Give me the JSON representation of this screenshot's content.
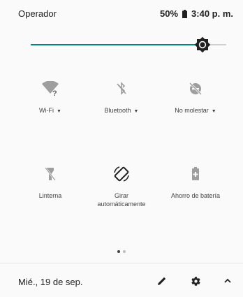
{
  "status_bar": {
    "carrier": "Operador",
    "battery_percent": "50%",
    "time": "3:40 p. m."
  },
  "brightness": {
    "level": 0.88,
    "accent_color": "#00897b"
  },
  "tiles": [
    {
      "label": "Wi-Fi",
      "icon": "wifi-off-icon",
      "has_dropdown": true,
      "caret": "▼"
    },
    {
      "label": "Bluetooth",
      "icon": "bluetooth-off-icon",
      "has_dropdown": true,
      "caret": "▼"
    },
    {
      "label": "No molestar",
      "icon": "do-not-disturb-off-icon",
      "has_dropdown": true,
      "caret": "▼"
    },
    {
      "label": "Linterna",
      "icon": "flashlight-off-icon",
      "has_dropdown": false
    },
    {
      "label": "Girar automáticamente",
      "icon": "auto-rotate-icon",
      "has_dropdown": false
    },
    {
      "label": "Ahorro de batería",
      "icon": "battery-saver-icon",
      "has_dropdown": false
    }
  ],
  "pager": {
    "pages": 2,
    "active": 0
  },
  "footer": {
    "date": "Mié., 19 de sep.",
    "edit_icon": "pencil-icon",
    "settings_icon": "gear-icon",
    "collapse_icon": "chevron-up-icon"
  }
}
